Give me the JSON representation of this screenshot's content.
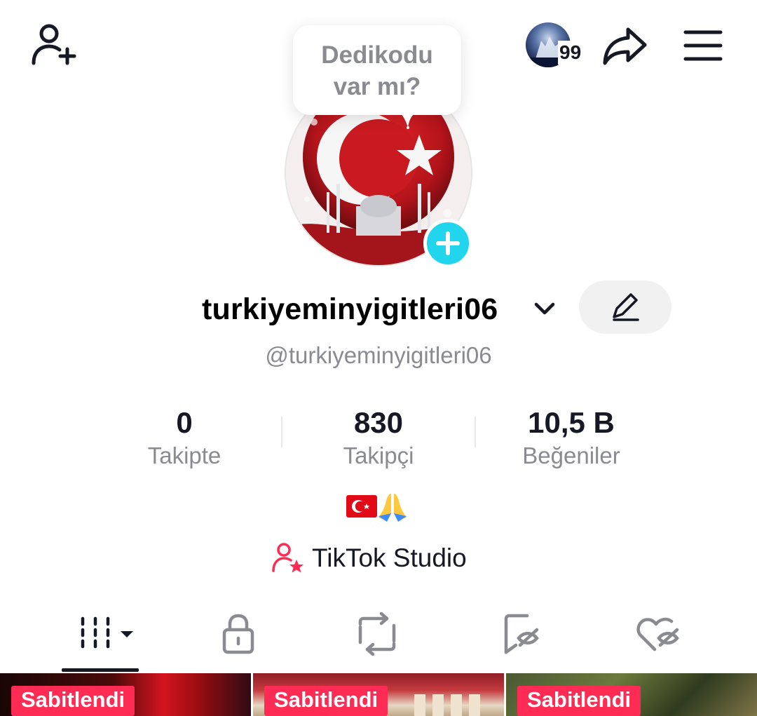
{
  "header": {
    "story_count": "99",
    "bubble_text": "Dedikodu var mı?"
  },
  "profile": {
    "username": "turkiyeminyigitleri06",
    "handle": "@turkiyeminyigitleri06",
    "bio": "🇹🇷🙏",
    "studio_label": "TikTok Studio"
  },
  "stats": [
    {
      "value": "0",
      "label": "Takipte"
    },
    {
      "value": "830",
      "label": "Takipçi"
    },
    {
      "value": "10,5 B",
      "label": "Beğeniler"
    }
  ],
  "tabs": [
    {
      "icon": "grid-icon",
      "active": true
    },
    {
      "icon": "lock-icon",
      "active": false
    },
    {
      "icon": "repost-icon",
      "active": false
    },
    {
      "icon": "favorites-hidden-icon",
      "active": false
    },
    {
      "icon": "liked-hidden-icon",
      "active": false
    }
  ],
  "videos": [
    {
      "badge": "Sabitlendi"
    },
    {
      "badge": "Sabitlendi"
    },
    {
      "badge": "Sabitlendi"
    }
  ],
  "colors": {
    "accent_pink": "#fe2c55",
    "plus_cyan": "#20d5ec",
    "text_primary": "#161823",
    "text_secondary": "#8a8b91"
  }
}
